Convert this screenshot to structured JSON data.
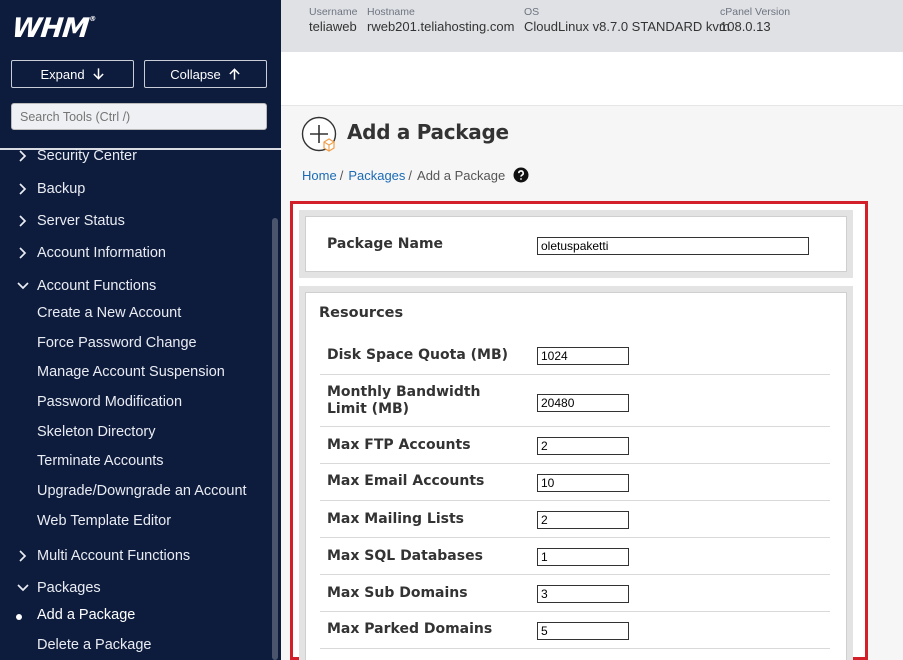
{
  "app": {
    "logo": "WHM",
    "logo_mark": "®"
  },
  "sidebar": {
    "expand_label": "Expand",
    "collapse_label": "Collapse",
    "search_placeholder": "Search Tools (Ctrl /)",
    "items": [
      {
        "label": "Security Center",
        "expanded": false
      },
      {
        "label": "Backup",
        "expanded": false
      },
      {
        "label": "Server Status",
        "expanded": false
      },
      {
        "label": "Account Information",
        "expanded": false
      },
      {
        "label": "Account Functions",
        "expanded": true
      },
      {
        "label": "Multi Account Functions",
        "expanded": false
      },
      {
        "label": "Packages",
        "expanded": true
      }
    ],
    "account_functions_sub": [
      "Create a New Account",
      "Force Password Change",
      "Manage Account Suspension",
      "Password Modification",
      "Skeleton Directory",
      "Terminate Accounts",
      "Upgrade/Downgrade an Account",
      "Web Template Editor"
    ],
    "packages_sub": [
      {
        "label": "Add a Package",
        "active": true
      },
      {
        "label": "Delete a Package",
        "active": false
      }
    ]
  },
  "header": {
    "username_label": "Username",
    "username": "teliaweb",
    "hostname_label": "Hostname",
    "hostname": "rweb201.teliahosting.com",
    "os_label": "OS",
    "os": "CloudLinux v8.7.0 STANDARD kvm",
    "cpanel_label": "cPanel Version",
    "cpanel": "108.0.13"
  },
  "page": {
    "title": "Add a Package",
    "breadcrumb": {
      "home": "Home",
      "packages": "Packages",
      "current": "Add a Package"
    }
  },
  "form": {
    "package_name_label": "Package Name",
    "package_name_value": "oletuspaketti",
    "resources_title": "Resources",
    "fields": [
      {
        "label": "Disk Space Quota (MB)",
        "value": "1024"
      },
      {
        "label": "Monthly Bandwidth Limit (MB)",
        "value": "20480"
      },
      {
        "label": "Max FTP Accounts",
        "value": "2"
      },
      {
        "label": "Max Email Accounts",
        "value": "10"
      },
      {
        "label": "Max Mailing Lists",
        "value": "2"
      },
      {
        "label": "Max SQL Databases",
        "value": "1"
      },
      {
        "label": "Max Sub Domains",
        "value": "3"
      },
      {
        "label": "Max Parked Domains",
        "value": "5"
      }
    ]
  },
  "colors": {
    "sidebar_bg": "#0d1b3d",
    "highlight_border": "#d31f2a",
    "link": "#1c6bb5"
  }
}
